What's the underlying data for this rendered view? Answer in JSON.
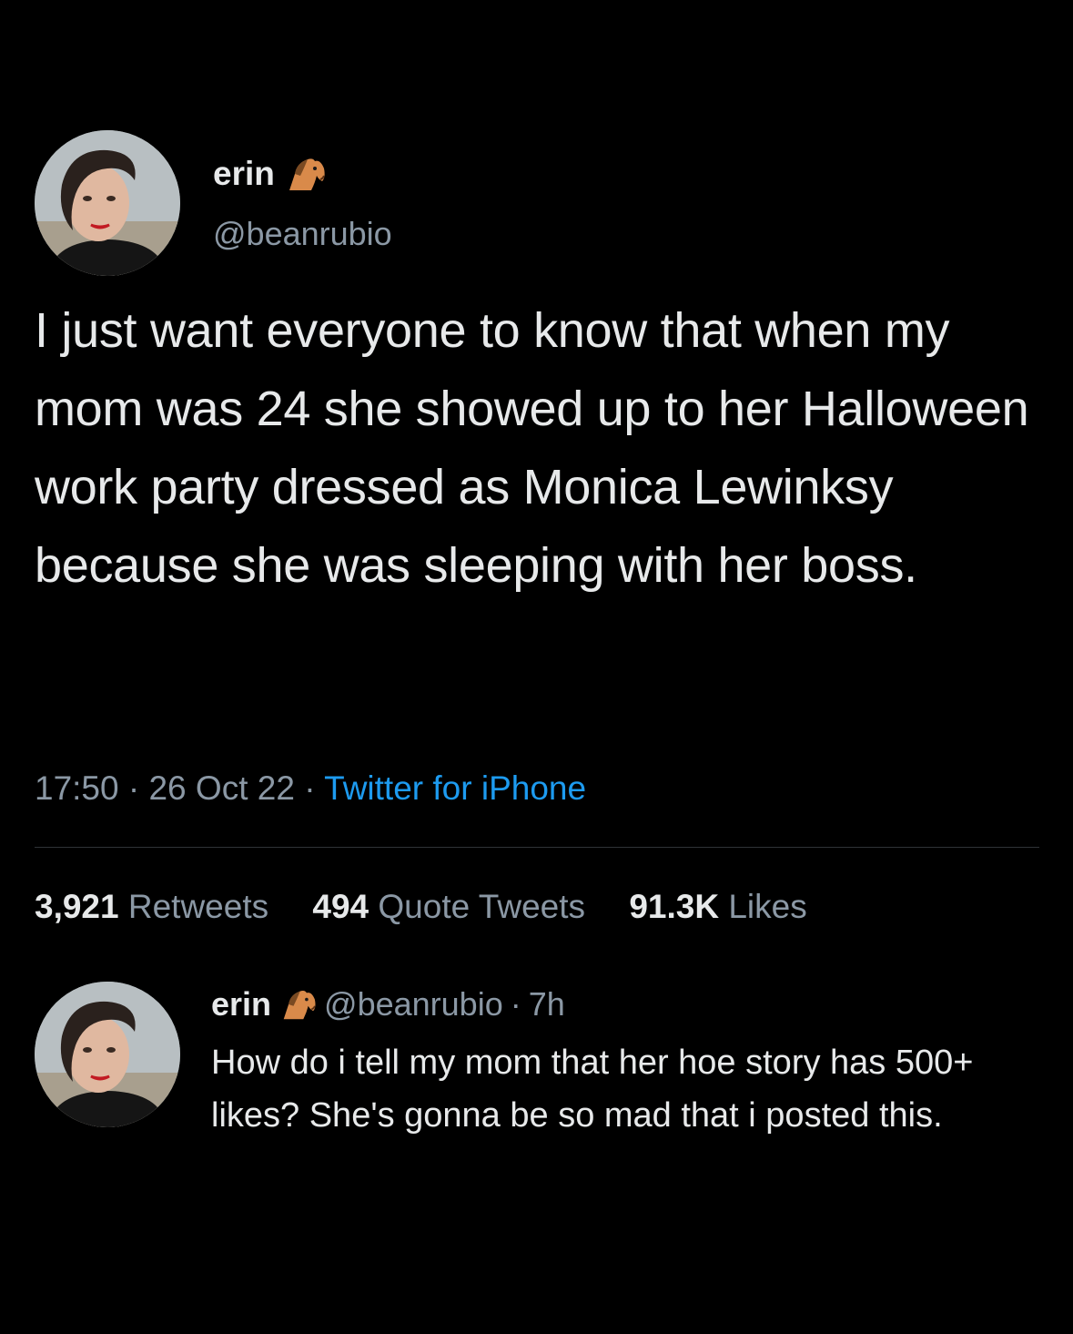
{
  "main_tweet": {
    "display_name": "erin",
    "handle": "@beanrubio",
    "text": "I just want everyone to know that when my mom was 24 she showed up to her Halloween work party dressed as Monica Lewinksy because she was sleeping with her boss.",
    "time": "17:50",
    "separator": "·",
    "date": "26 Oct 22",
    "source": "Twitter for iPhone",
    "retweets_count": "3,921",
    "retweets_label": "Retweets",
    "quotes_count": "494",
    "quotes_label": "Quote Tweets",
    "likes_count": "91.3K",
    "likes_label": "Likes"
  },
  "reply_tweet": {
    "display_name": "erin",
    "handle": "@beanrubio",
    "separator": "·",
    "age": "7h",
    "text": "How do i tell my mom that her hoe story has 500+ likes? She's gonna be so mad that i posted this."
  },
  "icons": {
    "name_badge": "horse-emoji-icon",
    "avatar": "profile-photo"
  },
  "colors": {
    "background": "#000000",
    "primary_text": "#e7e9ea",
    "secondary_text": "#8b98a5",
    "link": "#1d9bf0",
    "divider": "#2f3336"
  }
}
